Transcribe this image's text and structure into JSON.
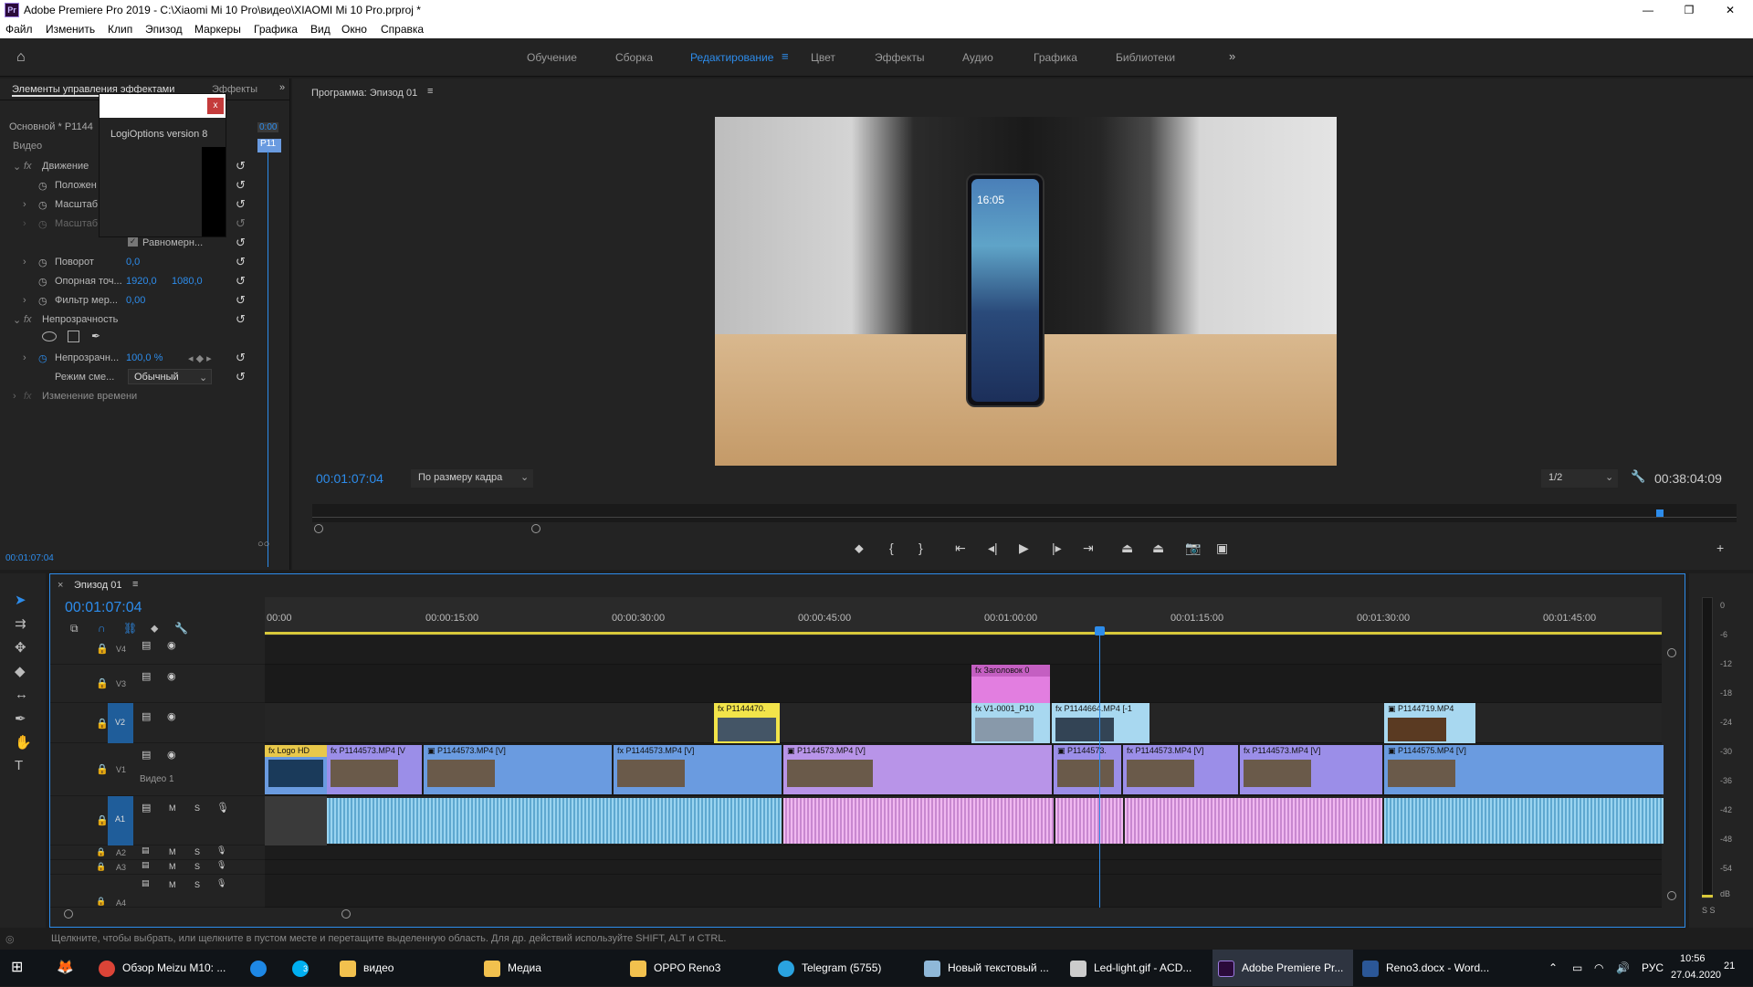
{
  "window": {
    "title": "Adobe Premiere Pro 2019 - C:\\Xiaomi Mi 10 Pro\\видео\\XIAOMI Mi 10 Pro.prproj *",
    "app_icon": "Pr",
    "controls": [
      "—",
      "❐",
      "✕"
    ]
  },
  "menu": [
    "Файл",
    "Изменить",
    "Клип",
    "Эпизод",
    "Маркеры",
    "Графика",
    "Вид",
    "Окно",
    "Справка"
  ],
  "workspaces": [
    {
      "label": "Обучение",
      "active": false
    },
    {
      "label": "Сборка",
      "active": false
    },
    {
      "label": "Редактирование",
      "active": true
    },
    {
      "label": "Цвет",
      "active": false
    },
    {
      "label": "Эффекты",
      "active": false
    },
    {
      "label": "Аудио",
      "active": false
    },
    {
      "label": "Графика",
      "active": false
    },
    {
      "label": "Библиотеки",
      "active": false
    }
  ],
  "effect_controls": {
    "tab1": "Элементы управления эффектами",
    "tab2": "Эффекты",
    "source": "Основной * P1144",
    "section": "Видео",
    "mini_time": "0:00",
    "mini_clip": "P11",
    "popup_text": "LogiOptions version 8",
    "popup_close": "x",
    "rows": [
      {
        "label": "Движение",
        "fx": true
      },
      {
        "label": "Положен",
        "value": ""
      },
      {
        "label": "Масштаб",
        "value": ""
      },
      {
        "label": "Масштаб",
        "value": ""
      },
      {
        "label": "Равномерн...",
        "checkbox": true
      },
      {
        "label": "Поворот",
        "value": "0,0"
      },
      {
        "label": "Опорная точ...",
        "value": "1920,0",
        "value2": "1080,0"
      },
      {
        "label": "Фильтр мер...",
        "value": "0,00"
      },
      {
        "label": "Непрозрачность",
        "fx": true
      },
      {
        "label": "Непрозрачн...",
        "value": "100,0 %"
      },
      {
        "label": "Режим сме...",
        "value": "Обычный"
      },
      {
        "label": "Изменение времени",
        "fx": true
      }
    ],
    "timecode": "00:01:07:04"
  },
  "program": {
    "title": "Программа: Эпизод 01",
    "timecode": "00:01:07:04",
    "fit": "По размеру кадра",
    "resolution": "1/2",
    "duration": "00:38:04:09",
    "phone_time": "16:05"
  },
  "timeline": {
    "tab": "Эпизод 01",
    "timecode": "00:01:07:04",
    "ruler": [
      "00:00",
      "00:00:15:00",
      "00:00:30:00",
      "00:00:45:00",
      "00:01:00:00",
      "00:01:15:00",
      "00:01:30:00",
      "00:01:45:00"
    ],
    "tracks": [
      {
        "id": "V4",
        "type": "video"
      },
      {
        "id": "V3",
        "type": "video"
      },
      {
        "id": "V2",
        "type": "video",
        "targeted": true
      },
      {
        "id": "V1",
        "type": "video",
        "name": "Видео 1"
      },
      {
        "id": "A1",
        "type": "audio",
        "targeted": true
      },
      {
        "id": "A2",
        "type": "audio"
      },
      {
        "id": "A3",
        "type": "audio"
      },
      {
        "id": "A4",
        "type": "audio"
      }
    ],
    "clips_v3": [
      {
        "label": "Заголовок 0",
        "color": "#e27ee0"
      }
    ],
    "clips_v2": [
      {
        "label": "P1144470.",
        "color": "#f2e44a"
      },
      {
        "label": "V1-0001_P10",
        "color": "#a8d8f0"
      },
      {
        "label": "P1144664.MP4 [-1",
        "color": "#a8d8f0"
      },
      {
        "label": "P1144719.MP4",
        "color": "#a8d8f0"
      }
    ],
    "clips_v1": [
      {
        "label": "Logo HD",
        "color": "#6a9be0"
      },
      {
        "label": "P1144573.MP4 [V",
        "color": "#9b8ee8"
      },
      {
        "label": "P1144573.MP4 [V]",
        "color": "#6a9be0"
      },
      {
        "label": "P1144573.MP4 [V]",
        "color": "#6a9be0"
      },
      {
        "label": "P1144573.MP4 [V]",
        "color": "#b894e8"
      },
      {
        "label": "P1144573.",
        "color": "#9b8ee8"
      },
      {
        "label": "P1144573.MP4 [V]",
        "color": "#9b8ee8"
      },
      {
        "label": "P1144573.MP4 [V]",
        "color": "#9b8ee8"
      },
      {
        "label": "P1144575.MP4 [V]",
        "color": "#6a9be0"
      }
    ],
    "meter_scale": [
      "0",
      "-6",
      "-12",
      "-18",
      "-24",
      "-30",
      "-36",
      "-42",
      "-48",
      "-54",
      "dB"
    ],
    "meter_footer": "S S"
  },
  "status": "Щелкните, чтобы выбрать, или щелкните в пустом месте и перетащите выделенную область. Для др. действий используйте SHIFT, ALT и CTRL.",
  "taskbar": {
    "items": [
      {
        "label": "Обзор Meizu M10: ...",
        "icon": "chrome-icon",
        "color": "#db4437"
      },
      {
        "label": "",
        "icon": "edge-icon",
        "color": "#1e88e5"
      },
      {
        "label": "",
        "icon": "skype-icon",
        "color": "#00aff0",
        "badge": "3"
      },
      {
        "label": "видео",
        "icon": "folder-icon",
        "color": "#f2c14e"
      },
      {
        "label": "Медиа",
        "icon": "folder-icon",
        "color": "#f2c14e"
      },
      {
        "label": "OPPO Reno3",
        "icon": "folder-icon",
        "color": "#f2c14e"
      },
      {
        "label": "Telegram (5755)",
        "icon": "telegram-icon",
        "color": "#2aa3e0"
      },
      {
        "label": "Новый текстовый ...",
        "icon": "notepad-icon",
        "color": "#8fb8d8"
      },
      {
        "label": "Led-light.gif - ACD...",
        "icon": "acdsee-icon",
        "color": "#cccccc"
      },
      {
        "label": "Adobe Premiere Pr...",
        "icon": "premiere-icon",
        "color": "#2a0a3a",
        "active": true
      },
      {
        "label": "Reno3.docx - Word...",
        "icon": "word-icon",
        "color": "#2b5797"
      }
    ],
    "lang": "РУС",
    "time": "10:56",
    "date": "27.04.2020",
    "notif": "21"
  }
}
